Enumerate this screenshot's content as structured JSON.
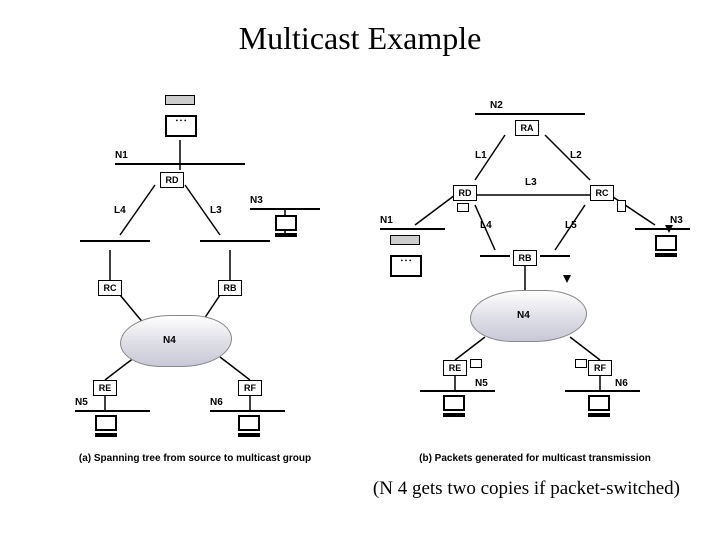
{
  "title": "Multicast Example",
  "note": "(N 4 gets two copies if packet-switched)",
  "left": {
    "caption": "(a) Spanning tree from source to multicast group",
    "nets": [
      "N1",
      "N3",
      "N4",
      "N5",
      "N6"
    ],
    "routers": [
      "RD",
      "RC",
      "RB",
      "RE",
      "RF"
    ],
    "links": [
      "L4",
      "L3"
    ]
  },
  "right": {
    "caption": "(b) Packets generated for multicast transmission",
    "nets": [
      "N1",
      "N2",
      "N3",
      "N4",
      "N5",
      "N6"
    ],
    "routers": [
      "RA",
      "RD",
      "RB",
      "RC",
      "RE",
      "RF"
    ],
    "links": [
      "L1",
      "L2",
      "L3",
      "L4",
      "L5"
    ]
  }
}
